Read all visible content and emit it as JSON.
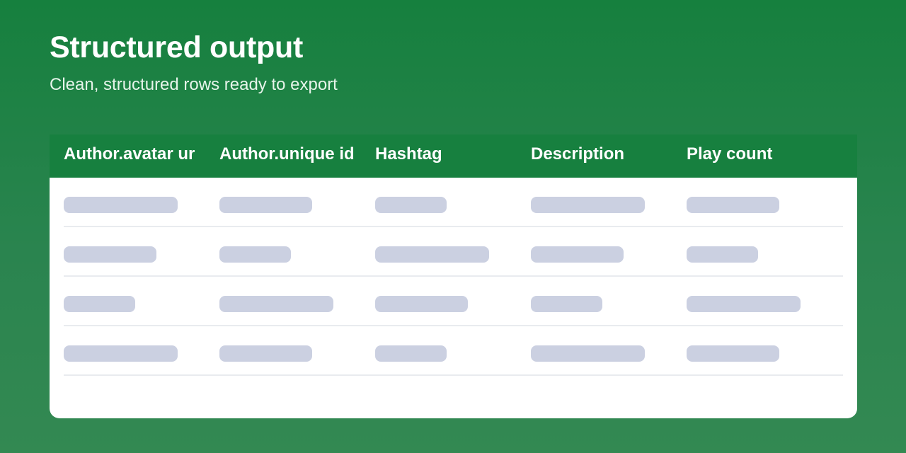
{
  "page": {
    "title": "Structured output",
    "subtitle": "Clean, structured rows ready to export"
  },
  "table": {
    "columns": [
      "Author.avatar ur",
      "Author.unique id",
      "Hashtag",
      "Description",
      "Play count"
    ],
    "rows_state": "loading-skeleton",
    "row_count": 4
  },
  "colors": {
    "background_top": "#16803e",
    "background_bottom": "#338952",
    "header_bg": "#17803f",
    "skeleton": "#cbd0e1",
    "divider": "#e9ebef"
  }
}
